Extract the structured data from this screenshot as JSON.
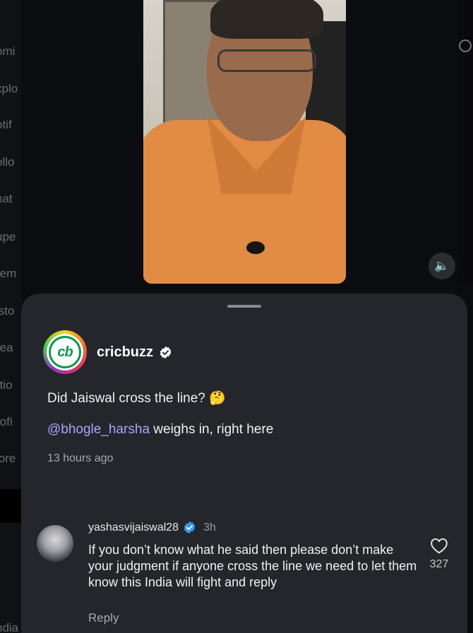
{
  "sidebar": {
    "items": [
      "omi",
      "xplo",
      "otif",
      "ollo",
      "hat",
      "upe",
      "rem",
      "isto",
      "rea",
      "rtio",
      "rofi",
      "lore",
      "ndia"
    ]
  },
  "controls": {
    "sound_icon": "speaker-icon",
    "sound_glyph": "🔈"
  },
  "post": {
    "account_name": "cricbuzz",
    "logo_text": "cb",
    "caption_line1": "Did Jaiswal cross the line? 🤔",
    "mention": "@bhogle_harsha",
    "caption_line2_rest": " weighs in, right here",
    "time": "13 hours ago"
  },
  "comment": {
    "username": "yashasvijaiswal28",
    "age": "3h",
    "text": "If you don’t know what he said then please don’t make your judgment if  anyone cross the line we need to let them know this India will fight and reply",
    "reply_label": "Reply",
    "like_count": "327"
  },
  "colors": {
    "accent_verified": "#3897f0",
    "mention": "#a9a5ff",
    "sheet_bg": "#25262b"
  }
}
